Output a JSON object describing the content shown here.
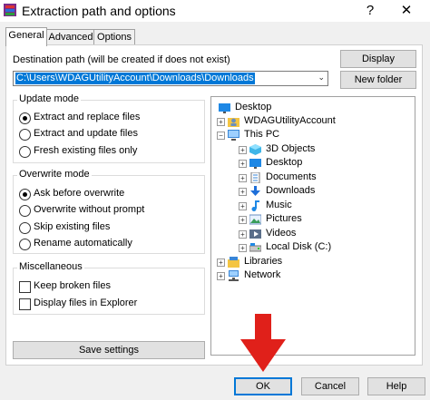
{
  "window": {
    "title": "Extraction path and options",
    "help_glyph": "?",
    "close_glyph": "✕"
  },
  "tabs": [
    {
      "label": "General",
      "active": true
    },
    {
      "label": "Advanced",
      "active": false
    },
    {
      "label": "Options",
      "active": false
    }
  ],
  "destination": {
    "label": "Destination path (will be created if does not exist)",
    "value": "C:\\Users\\WDAGUtilityAccount\\Downloads\\Downloads"
  },
  "side_buttons": {
    "display": "Display",
    "new_folder": "New folder"
  },
  "update_mode": {
    "title": "Update mode",
    "options": [
      {
        "label": "Extract and replace files",
        "selected": true
      },
      {
        "label": "Extract and update files",
        "selected": false
      },
      {
        "label": "Fresh existing files only",
        "selected": false
      }
    ]
  },
  "overwrite_mode": {
    "title": "Overwrite mode",
    "options": [
      {
        "label": "Ask before overwrite",
        "selected": true
      },
      {
        "label": "Overwrite without prompt",
        "selected": false
      },
      {
        "label": "Skip existing files",
        "selected": false
      },
      {
        "label": "Rename automatically",
        "selected": false
      }
    ]
  },
  "misc": {
    "title": "Miscellaneous",
    "options": [
      {
        "label": "Keep broken files",
        "checked": false
      },
      {
        "label": "Display files in Explorer",
        "checked": false
      }
    ]
  },
  "save_settings": "Save settings",
  "tree": [
    {
      "label": "Desktop",
      "icon": "desktop-icon",
      "expander": ""
    },
    {
      "label": "WDAGUtilityAccount",
      "icon": "user-icon",
      "expander": "+"
    },
    {
      "label": "This PC",
      "icon": "pc-icon",
      "expander": "−"
    },
    {
      "label": "3D Objects",
      "icon": "3d-objects-icon",
      "expander": "+"
    },
    {
      "label": "Desktop",
      "icon": "desktop-icon",
      "expander": "+"
    },
    {
      "label": "Documents",
      "icon": "documents-icon",
      "expander": "+"
    },
    {
      "label": "Downloads",
      "icon": "downloads-icon",
      "expander": "+"
    },
    {
      "label": "Music",
      "icon": "music-icon",
      "expander": "+"
    },
    {
      "label": "Pictures",
      "icon": "pictures-icon",
      "expander": "+"
    },
    {
      "label": "Videos",
      "icon": "videos-icon",
      "expander": "+"
    },
    {
      "label": "Local Disk (C:)",
      "icon": "disk-icon",
      "expander": "+"
    },
    {
      "label": "Libraries",
      "icon": "libraries-icon",
      "expander": "+"
    },
    {
      "label": "Network",
      "icon": "network-icon",
      "expander": "+"
    }
  ],
  "footer": {
    "ok": "OK",
    "cancel": "Cancel",
    "help": "Help"
  },
  "colors": {
    "accent": "#0078d7",
    "selection": "#0078d7",
    "annotation_arrow": "#e0201a"
  }
}
